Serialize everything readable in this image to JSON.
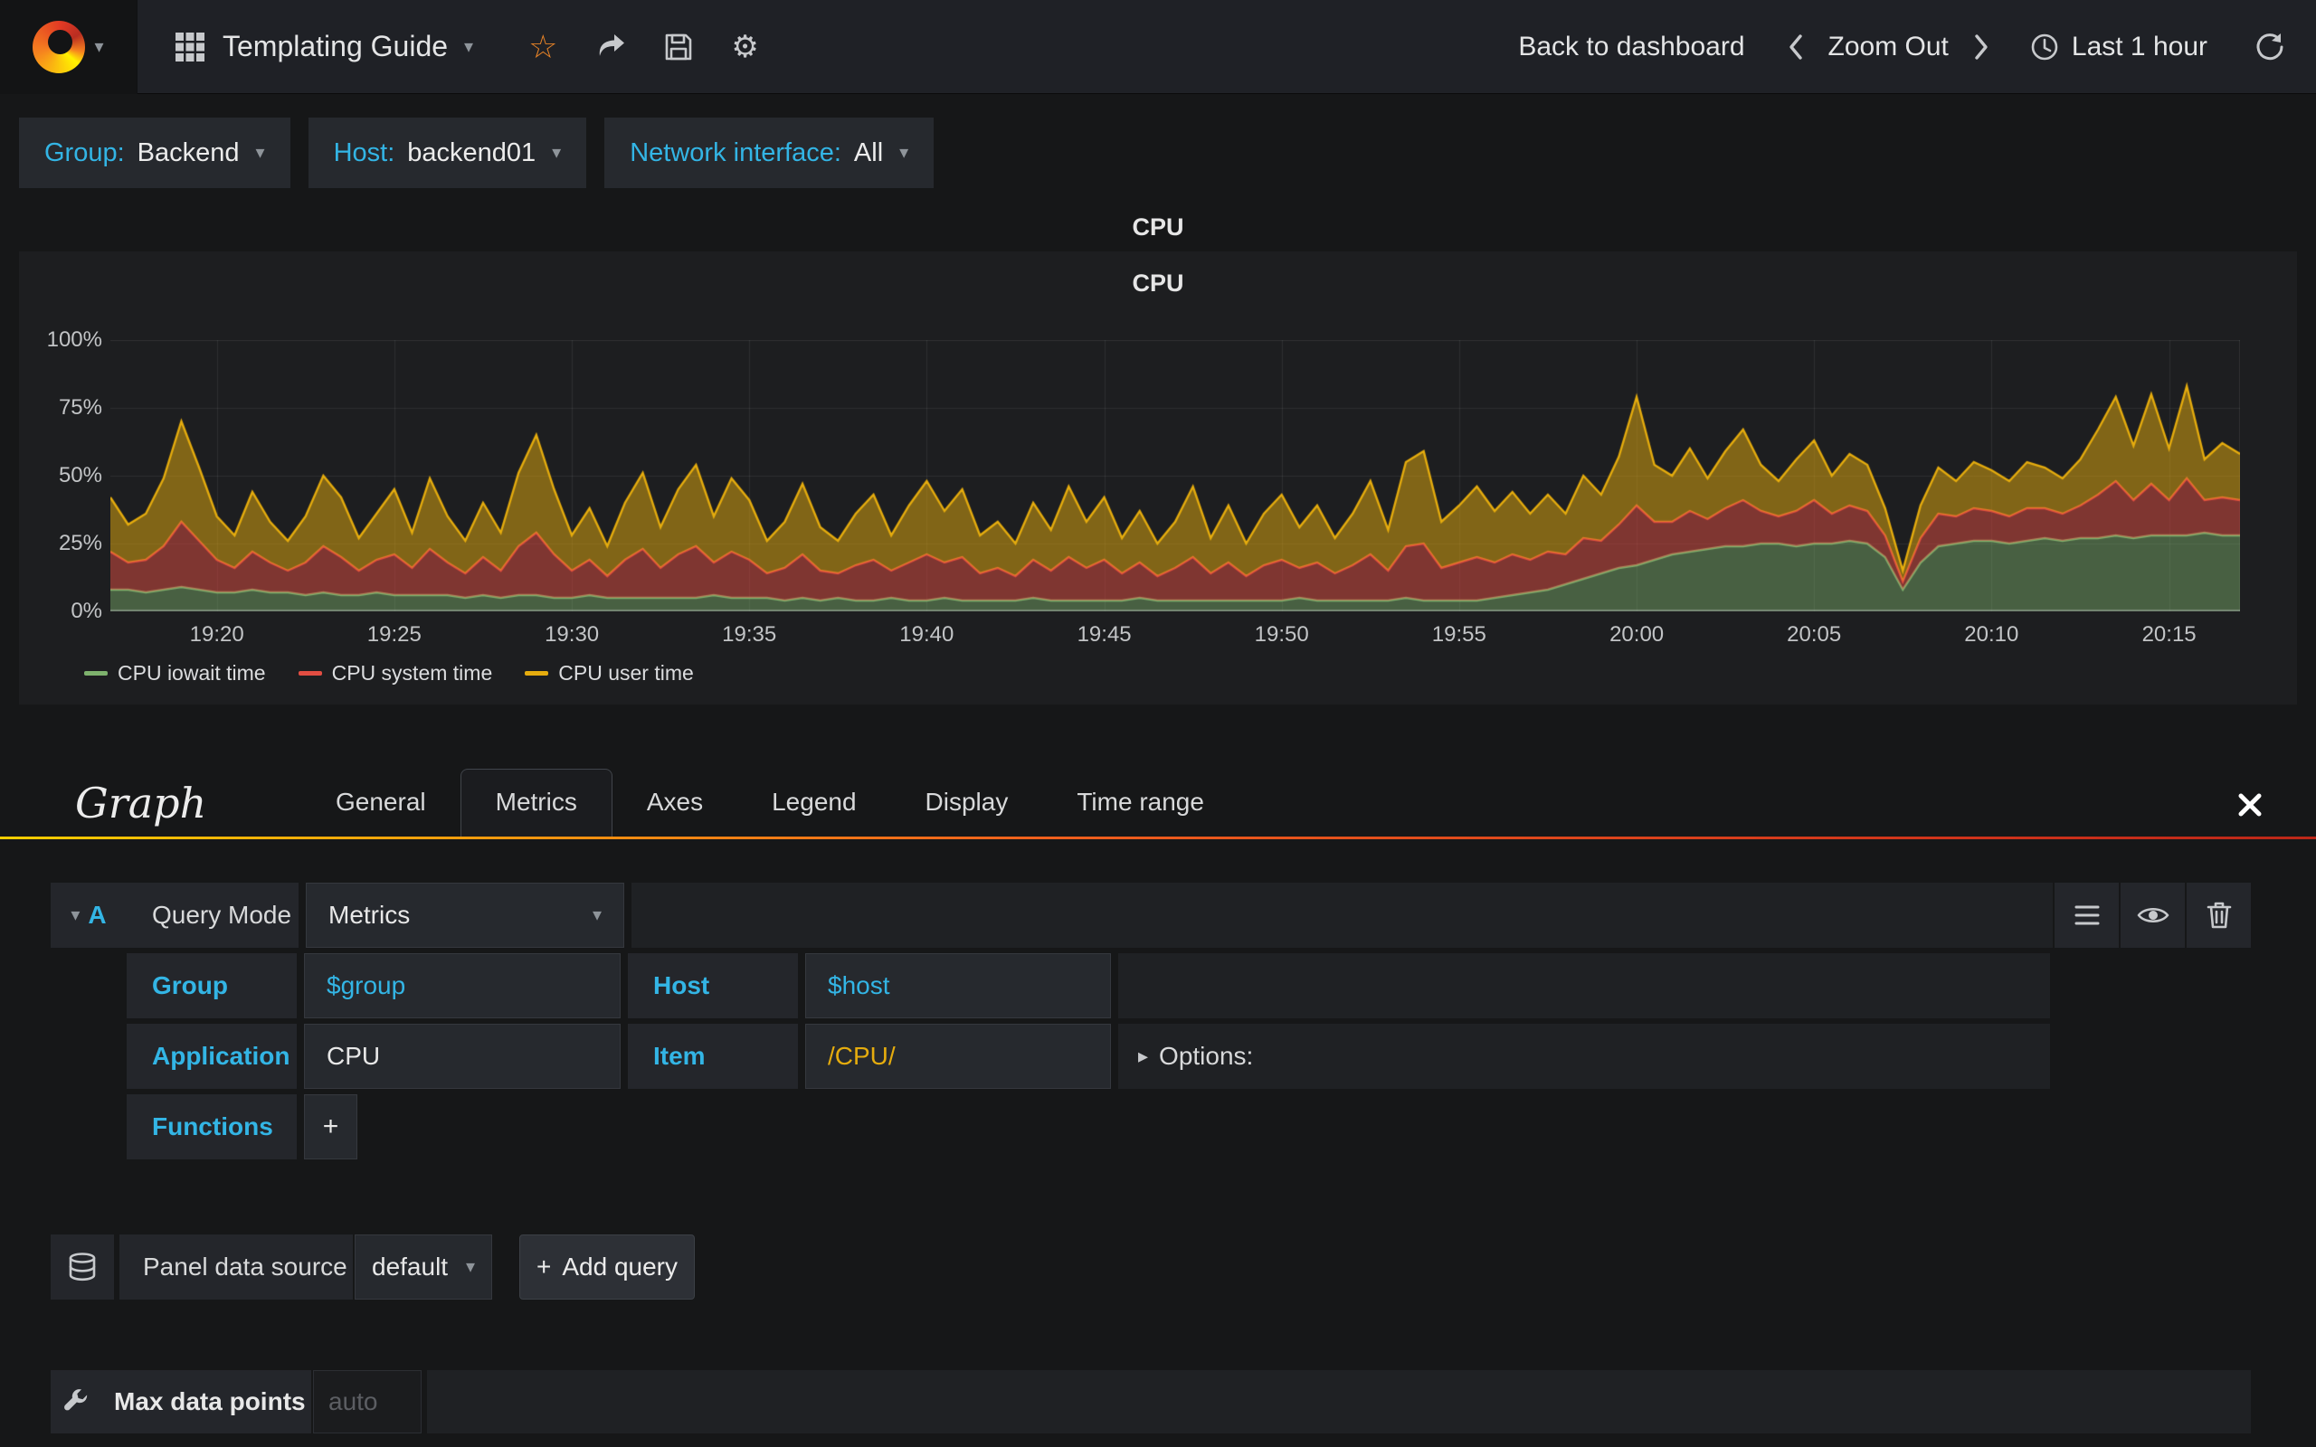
{
  "colors": {
    "accent": "#33b5e5",
    "item_value": "#e5ac0e",
    "star": "#e78327",
    "text": "#d8d9da",
    "tab_gradient": [
      "#ffcf00",
      "#f0601d",
      "#bc2718"
    ]
  },
  "navbar": {
    "dashboard_title": "Templating Guide",
    "back_label": "Back to dashboard",
    "zoom_out_label": "Zoom Out",
    "time_label": "Last 1 hour"
  },
  "variables": [
    {
      "label": "Group:",
      "value": "Backend"
    },
    {
      "label": "Host:",
      "value": "backend01"
    },
    {
      "label": "Network interface:",
      "value": "All"
    }
  ],
  "panel": {
    "header_title": "CPU"
  },
  "chart_data": {
    "type": "area",
    "stacked": true,
    "title": "CPU",
    "ylim": [
      0,
      100
    ],
    "grid": true,
    "legend_position": "bottom-left",
    "y_ticks": [
      "0%",
      "25%",
      "50%",
      "75%",
      "100%"
    ],
    "x_ticks": [
      {
        "label": "19:20",
        "f": 0.05
      },
      {
        "label": "19:25",
        "f": 0.1333
      },
      {
        "label": "19:30",
        "f": 0.2167
      },
      {
        "label": "19:35",
        "f": 0.3
      },
      {
        "label": "19:40",
        "f": 0.3833
      },
      {
        "label": "19:45",
        "f": 0.4667
      },
      {
        "label": "19:50",
        "f": 0.55
      },
      {
        "label": "19:55",
        "f": 0.6333
      },
      {
        "label": "20:00",
        "f": 0.7167
      },
      {
        "label": "20:05",
        "f": 0.8
      },
      {
        "label": "20:10",
        "f": 0.8833
      },
      {
        "label": "20:15",
        "f": 0.9667
      }
    ],
    "series": [
      {
        "name": "CPU iowait time",
        "color": "#7eb26d",
        "fill_alpha": 0.45,
        "values": [
          8,
          8,
          7,
          8,
          9,
          8,
          7,
          7,
          8,
          7,
          7,
          6,
          7,
          6,
          6,
          7,
          6,
          6,
          6,
          6,
          5,
          6,
          5,
          6,
          6,
          5,
          5,
          6,
          5,
          5,
          5,
          5,
          5,
          5,
          6,
          5,
          5,
          5,
          4,
          5,
          4,
          5,
          4,
          4,
          5,
          4,
          4,
          5,
          4,
          4,
          4,
          4,
          5,
          4,
          4,
          4,
          4,
          4,
          5,
          4,
          4,
          4,
          4,
          4,
          4,
          4,
          4,
          5,
          4,
          4,
          4,
          4,
          4,
          5,
          4,
          4,
          4,
          4,
          5,
          6,
          7,
          8,
          10,
          12,
          14,
          16,
          17,
          19,
          21,
          22,
          23,
          24,
          24,
          25,
          25,
          24,
          25,
          25,
          26,
          25,
          20,
          8,
          18,
          24,
          25,
          26,
          26,
          25,
          26,
          27,
          26,
          27,
          27,
          28,
          27,
          28,
          28,
          28,
          29,
          28,
          28
        ]
      },
      {
        "name": "CPU system time",
        "color": "#e24d42",
        "fill_alpha": 0.5,
        "values": [
          14,
          10,
          12,
          16,
          24,
          18,
          12,
          9,
          14,
          11,
          8,
          12,
          17,
          14,
          9,
          12,
          15,
          10,
          17,
          12,
          9,
          14,
          10,
          18,
          23,
          16,
          10,
          13,
          8,
          14,
          18,
          11,
          16,
          19,
          12,
          17,
          14,
          9,
          12,
          16,
          11,
          9,
          13,
          15,
          10,
          14,
          17,
          13,
          16,
          10,
          12,
          9,
          14,
          11,
          16,
          12,
          15,
          10,
          13,
          9,
          12,
          16,
          10,
          14,
          9,
          13,
          15,
          11,
          14,
          10,
          13,
          17,
          11,
          19,
          21,
          12,
          14,
          16,
          13,
          15,
          12,
          14,
          11,
          15,
          12,
          16,
          22,
          14,
          12,
          15,
          11,
          14,
          17,
          12,
          10,
          13,
          16,
          11,
          13,
          12,
          8,
          3,
          9,
          12,
          10,
          12,
          11,
          10,
          12,
          11,
          10,
          12,
          16,
          20,
          14,
          19,
          13,
          21,
          12,
          14,
          13
        ]
      },
      {
        "name": "CPU user time",
        "color": "#e5ac0e",
        "fill_alpha": 0.5,
        "values": [
          20,
          14,
          17,
          25,
          37,
          27,
          16,
          12,
          22,
          15,
          11,
          17,
          26,
          22,
          12,
          17,
          24,
          13,
          26,
          17,
          12,
          20,
          14,
          27,
          36,
          24,
          13,
          19,
          11,
          21,
          28,
          15,
          24,
          30,
          17,
          27,
          22,
          12,
          17,
          26,
          16,
          12,
          19,
          24,
          13,
          21,
          27,
          19,
          25,
          14,
          17,
          12,
          21,
          15,
          26,
          17,
          23,
          13,
          19,
          12,
          17,
          26,
          13,
          21,
          12,
          19,
          24,
          15,
          21,
          13,
          19,
          27,
          15,
          31,
          34,
          17,
          21,
          26,
          19,
          23,
          17,
          21,
          15,
          23,
          17,
          25,
          40,
          21,
          17,
          23,
          15,
          21,
          26,
          17,
          13,
          19,
          22,
          14,
          19,
          17,
          10,
          4,
          12,
          17,
          13,
          17,
          15,
          13,
          17,
          15,
          13,
          17,
          24,
          31,
          20,
          33,
          19,
          34,
          15,
          20,
          17
        ]
      }
    ]
  },
  "editor": {
    "panel_type": "Graph",
    "tabs": [
      {
        "label": "General",
        "active": false
      },
      {
        "label": "Metrics",
        "active": true
      },
      {
        "label": "Axes",
        "active": false
      },
      {
        "label": "Legend",
        "active": false
      },
      {
        "label": "Display",
        "active": false
      },
      {
        "label": "Time range",
        "active": false
      }
    ],
    "query": {
      "letter": "A",
      "mode_label": "Query Mode",
      "mode_value": "Metrics",
      "group_label": "Group",
      "group_value": "$group",
      "host_label": "Host",
      "host_value": "$host",
      "app_label": "Application",
      "app_value": "CPU",
      "item_label": "Item",
      "item_value": "/CPU/",
      "options_label": "Options:",
      "functions_label": "Functions",
      "add_function_label": "+"
    },
    "datasource": {
      "label": "Panel data source",
      "value": "default",
      "add_query_label": "Add query"
    },
    "max_data_points": {
      "label": "Max data points",
      "placeholder": "auto"
    }
  }
}
